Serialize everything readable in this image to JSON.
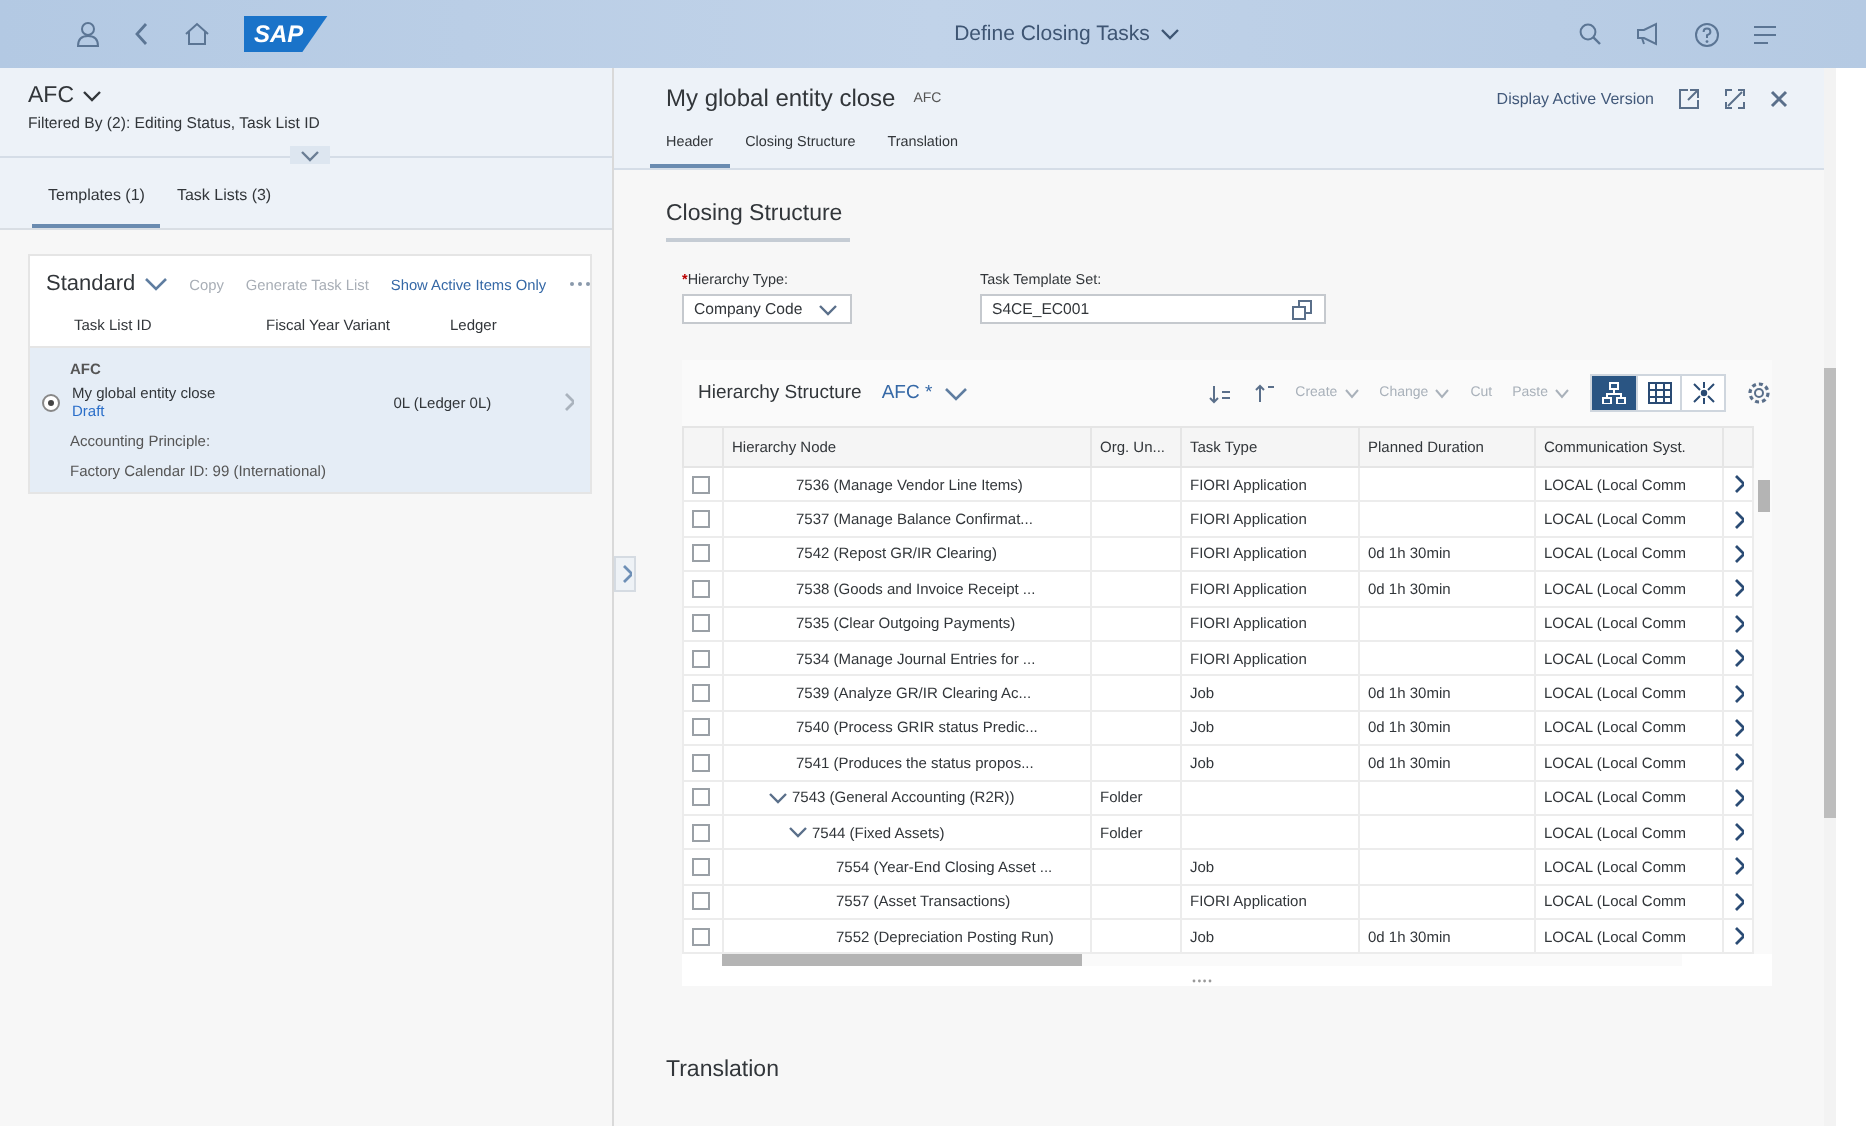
{
  "shell": {
    "logo": "SAP",
    "title": "Define Closing Tasks"
  },
  "master": {
    "title": "AFC",
    "filter": "Filtered By (2): Editing Status, Task List ID",
    "tabs": [
      {
        "label": "Templates (1)",
        "selected": true
      },
      {
        "label": "Task Lists (3)",
        "selected": false
      }
    ],
    "variant": "Standard",
    "actions": [
      {
        "label": "Copy",
        "disabled": true
      },
      {
        "label": "Generate Task List",
        "disabled": true
      },
      {
        "label": "Show Active Items Only",
        "disabled": false
      }
    ],
    "columns": [
      "Task List ID",
      "Fiscal Year Variant",
      "Ledger"
    ],
    "items": [
      {
        "title": "AFC",
        "name": "My global entity close",
        "status": "Draft",
        "ledger": "0L (Ledger 0L)",
        "selected": true,
        "attributes": [
          "Accounting Principle:",
          "Factory Calendar ID:  99 (International)"
        ]
      }
    ]
  },
  "detail": {
    "title": "My global entity close",
    "subtitle": "AFC",
    "action": "Display Active Version",
    "tabs": [
      {
        "label": "Header",
        "selected": true
      },
      {
        "label": "Closing Structure",
        "selected": false
      },
      {
        "label": "Translation",
        "selected": false
      }
    ],
    "section_title": "Closing Structure",
    "fields": [
      {
        "kind": "select",
        "marker": "*",
        "label": "Hierarchy Type:",
        "value": "Company Code"
      },
      {
        "kind": "valuehelp",
        "label": "Task Template Set:",
        "value": "S4CE_EC001"
      }
    ],
    "next_section_title": "Translation"
  },
  "table": {
    "title": "Hierarchy Structure",
    "variant": "AFC *",
    "toolbar": [
      {
        "label": "Create",
        "menu": true,
        "disabled": true
      },
      {
        "label": "Change",
        "menu": true,
        "disabled": true
      },
      {
        "label": "Cut",
        "menu": false,
        "disabled": true
      },
      {
        "label": "Paste",
        "menu": true,
        "disabled": true
      }
    ],
    "views": [
      {
        "kind": "hierarchy",
        "selected": true
      },
      {
        "kind": "grid",
        "selected": false
      },
      {
        "kind": "network",
        "selected": false
      }
    ],
    "columns": [
      "Hierarchy Node",
      "Org. Un...",
      "Task Type",
      "Planned Duration",
      "Communication Syst."
    ],
    "rows": [
      {
        "node": "7536 (Manage Vendor Line Items)",
        "task_type": "FIORI Application",
        "comm": "LOCAL (Local Comm",
        "checked": false
      },
      {
        "node": "7537 (Manage Balance Confirmat...",
        "task_type": "FIORI Application",
        "comm": "LOCAL (Local Comm",
        "checked": false
      },
      {
        "node": "7542 (Repost GR/IR Clearing)",
        "task_type": "FIORI Application",
        "duration": "0d 1h 30min",
        "comm": "LOCAL (Local Comm",
        "checked": false
      },
      {
        "node": "7538 (Goods and Invoice Receipt ...",
        "task_type": "FIORI Application",
        "duration": "0d 1h 30min",
        "comm": "LOCAL (Local Comm",
        "checked": false
      },
      {
        "node": "7535 (Clear Outgoing Payments)",
        "task_type": "FIORI Application",
        "comm": "LOCAL (Local Comm",
        "checked": false
      },
      {
        "node": "7534 (Manage Journal Entries for ...",
        "task_type": "FIORI Application",
        "comm": "LOCAL (Local Comm",
        "checked": false
      },
      {
        "node": "7539 (Analyze GR/IR Clearing Ac...",
        "task_type": "Job",
        "duration": "0d 1h 30min",
        "comm": "LOCAL (Local Comm",
        "checked": false
      },
      {
        "node": "7540 (Process GRIR status Predic...",
        "task_type": "Job",
        "duration": "0d 1h 30min",
        "comm": "LOCAL (Local Comm",
        "checked": false
      },
      {
        "node": "7541 (Produces the status propos...",
        "task_type": "Job",
        "duration": "0d 1h 30min",
        "comm": "LOCAL (Local Comm",
        "checked": false
      },
      {
        "node": "7543 (General Accounting (R2R))",
        "org_unit": "Folder",
        "comm": "LOCAL (Local Comm",
        "checked": false,
        "expanded": true,
        "children": [
          {
            "node": "7544 (Fixed Assets)",
            "org_unit": "Folder",
            "comm": "LOCAL (Local Comm",
            "checked": false,
            "expanded": true,
            "children": [
              {
                "node": "7554 (Year-End Closing Asset ...",
                "task_type": "Job",
                "comm": "LOCAL (Local Comm",
                "checked": false
              },
              {
                "node": "7557 (Asset Transactions)",
                "task_type": "FIORI Application",
                "comm": "LOCAL (Local Comm",
                "checked": false
              },
              {
                "node": "7552 (Depreciation Posting Run)",
                "task_type": "Job",
                "duration": "0d 1h 30min",
                "comm": "LOCAL (Local Comm",
                "checked": false
              }
            ]
          }
        ]
      }
    ]
  }
}
